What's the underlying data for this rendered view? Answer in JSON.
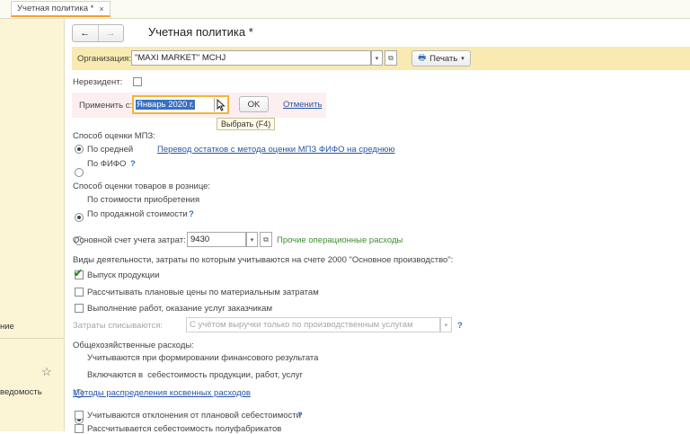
{
  "tab": {
    "label": "Учетная политика *",
    "close": "×"
  },
  "sidebar": {
    "item1": "ние",
    "item2": "ведомость"
  },
  "toolbar": {
    "back": "←",
    "forward": "→",
    "title": "Учетная политика *"
  },
  "org": {
    "label": "Организация:",
    "value": "\"MAXI MARKET\" MCHJ",
    "print_label": "Печать"
  },
  "nonresident": {
    "label": "Нерезидент:"
  },
  "apply": {
    "label": "Применить с:",
    "value": "Январь 2020 г.",
    "ok": "OK",
    "cancel": "Отменить",
    "tooltip": "Выбрать (F4)"
  },
  "mpz": {
    "heading": "Способ оценки МПЗ:",
    "opt1": "По средней",
    "opt2": "По ФИФО",
    "link": "Перевод остатков с метода оценки МПЗ ФИФО на среднюю"
  },
  "retail": {
    "heading": "Способ оценки товаров в рознице:",
    "opt1": "По стоимости приобретения",
    "opt2": "По продажной стоимости"
  },
  "cost_account": {
    "label": "Основной счет учета затрат:",
    "value": "9430",
    "desc": "Прочие операционные расходы"
  },
  "activities": {
    "heading": "Виды деятельности, затраты по которым учитываются на счете 2000 \"Основное производство\":",
    "item1": "Выпуск продукции",
    "item2": "Рассчитывать плановые цены по материальным затратам",
    "item3": "Выполнение работ, оказание услуг заказчикам",
    "writeoff_label": "Затраты списываются:",
    "writeoff_value": "С учётом выручки только по производственным услугам"
  },
  "overhead": {
    "heading": "Общехозяйственные расходы:",
    "opt1": "Учитываются при формировании финансового результата",
    "opt2": "Включаются в  себестоимость продукции, работ, услуг",
    "link": "Методы распределения косвенных расходов"
  },
  "more": {
    "item1": "Учитываются отклонения от плановой себестоимости",
    "item2": "Рассчитывается себестоимость полуфабрикатов"
  },
  "glyphs": {
    "help": "?",
    "star": "☆",
    "dd": "▾",
    "open": "⧉",
    "check": "✔",
    "print": "🖶"
  }
}
